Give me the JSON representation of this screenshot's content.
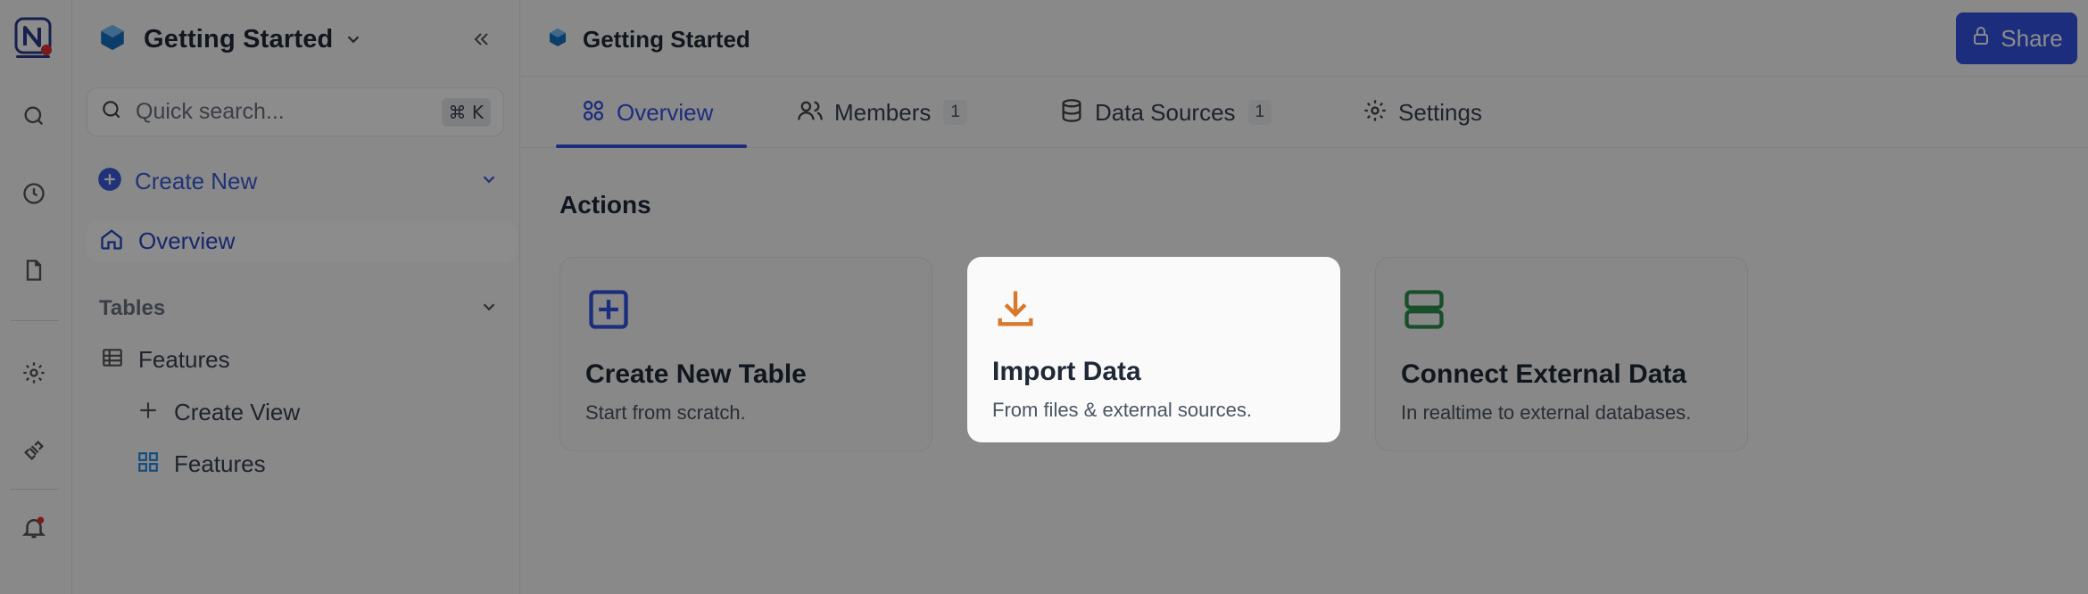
{
  "rail": {
    "logo_icon": "nocodb-logo-icon",
    "items": [
      "search-icon",
      "clock-icon",
      "file-icon",
      "gear-icon",
      "plug-icon",
      "bell-icon"
    ],
    "notification_dot_color": "#e03131"
  },
  "sidebar": {
    "workspace_title": "Getting Started",
    "search_placeholder": "Quick search...",
    "search_shortcut": "⌘ K",
    "create_new_label": "Create New",
    "overview_label": "Overview",
    "tables_header": "Tables",
    "tree": [
      {
        "label": "Features",
        "icon": "table-icon"
      },
      {
        "label": "Create View",
        "icon": "plus-icon"
      },
      {
        "label": "Features",
        "icon": "grid-view-icon"
      }
    ]
  },
  "header": {
    "breadcrumb": "Getting Started",
    "share_label": "Share"
  },
  "tabs": [
    {
      "label": "Overview",
      "icon": "overview-icon",
      "active": true
    },
    {
      "label": "Members",
      "icon": "users-icon",
      "count": "1"
    },
    {
      "label": "Data Sources",
      "icon": "database-icon",
      "count": "1"
    },
    {
      "label": "Settings",
      "icon": "gear-icon"
    }
  ],
  "main": {
    "actions_title": "Actions",
    "cards": [
      {
        "title": "Create New Table",
        "desc": "Start from scratch.",
        "icon": "plus-square-icon",
        "color": "#3353e6"
      },
      {
        "title": "Import Data",
        "desc": "From files & external sources.",
        "icon": "download-icon",
        "color": "#d9782a"
      },
      {
        "title": "Connect External Data",
        "desc": "In realtime to external databases.",
        "icon": "server-icon",
        "color": "#2f8f4e"
      }
    ]
  },
  "colors": {
    "accent": "#3353e6",
    "import_accent": "#d9782a",
    "connect_accent": "#2f8f4e"
  }
}
